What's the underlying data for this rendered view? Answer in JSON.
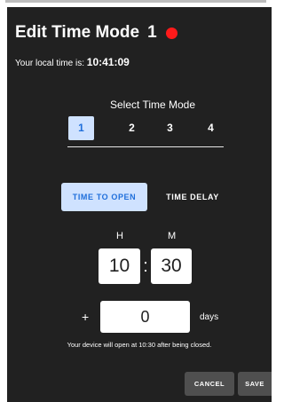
{
  "dialog": {
    "title": "Edit Time Mode",
    "mode_number": "1",
    "status_color": "#ff1a1a",
    "local_time_label": "Your local time is:",
    "local_time_value": "10:41:09"
  },
  "mode_select": {
    "label": "Select Time Mode",
    "options": [
      "1",
      "2",
      "3",
      "4"
    ],
    "selected": "1"
  },
  "type_toggle": {
    "time_to_open": "TIME TO OPEN",
    "time_delay": "TIME DELAY",
    "selected": "TIME TO OPEN"
  },
  "time": {
    "hour_label": "H",
    "minute_label": "M",
    "hour_value": "10",
    "separator": ":",
    "minute_value": "30"
  },
  "days": {
    "prefix": "+",
    "value": "0",
    "unit": "days"
  },
  "note": "Your device will open at 10:30 after being closed.",
  "actions": {
    "cancel": "CANCEL",
    "save": "SAVE"
  },
  "colors": {
    "dialog_bg": "#212121",
    "accent_bg": "#cfe2ff",
    "accent_text": "#1f6fdb",
    "action_bg": "#4f4f4f"
  }
}
